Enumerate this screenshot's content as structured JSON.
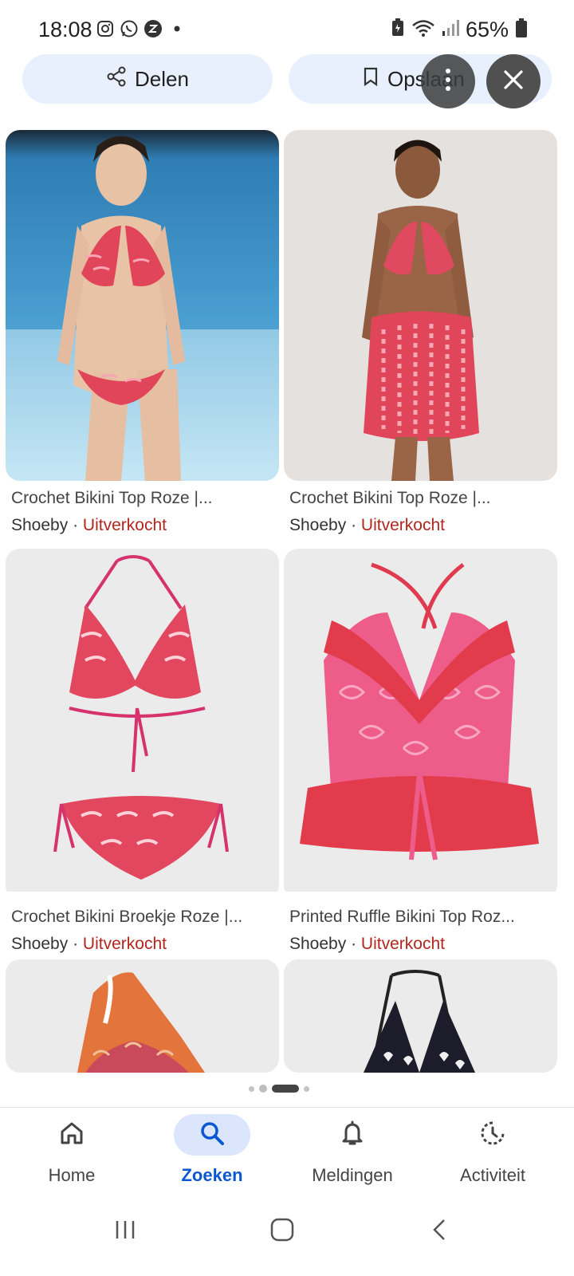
{
  "status_bar": {
    "time": "18:08",
    "battery": "65%",
    "icons": [
      "instagram-icon",
      "whatsapp-icon",
      "app-icon",
      "dot-icon",
      "battery-saver-icon",
      "wifi-icon",
      "signal-icon",
      "battery-icon"
    ]
  },
  "actions": {
    "share_label": "Delen",
    "save_label": "Opslaan"
  },
  "results": [
    {
      "title": "Crochet Bikini Top Roze |...",
      "store": "Shoeby",
      "separator": "·",
      "status": "Uitverkocht"
    },
    {
      "title": "Crochet Bikini Top Roze |...",
      "store": "Shoeby",
      "separator": "·",
      "status": "Uitverkocht"
    },
    {
      "title": "Crochet Bikini Broekje Roze |...",
      "store": "Shoeby",
      "separator": "·",
      "status": "Uitverkocht"
    },
    {
      "title": "Printed Ruffle Bikini Top Roz...",
      "store": "Shoeby",
      "separator": "·",
      "status": "Uitverkocht"
    }
  ],
  "bottom_nav": {
    "items": [
      {
        "label": "Home",
        "icon": "home-icon"
      },
      {
        "label": "Zoeken",
        "icon": "search-icon",
        "active": true
      },
      {
        "label": "Meldingen",
        "icon": "bell-icon"
      },
      {
        "label": "Activiteit",
        "icon": "activity-icon"
      }
    ]
  },
  "colors": {
    "accent": "#0b57d0",
    "pill_bg": "#e8f0fe",
    "sold_out": "#b3261e"
  }
}
